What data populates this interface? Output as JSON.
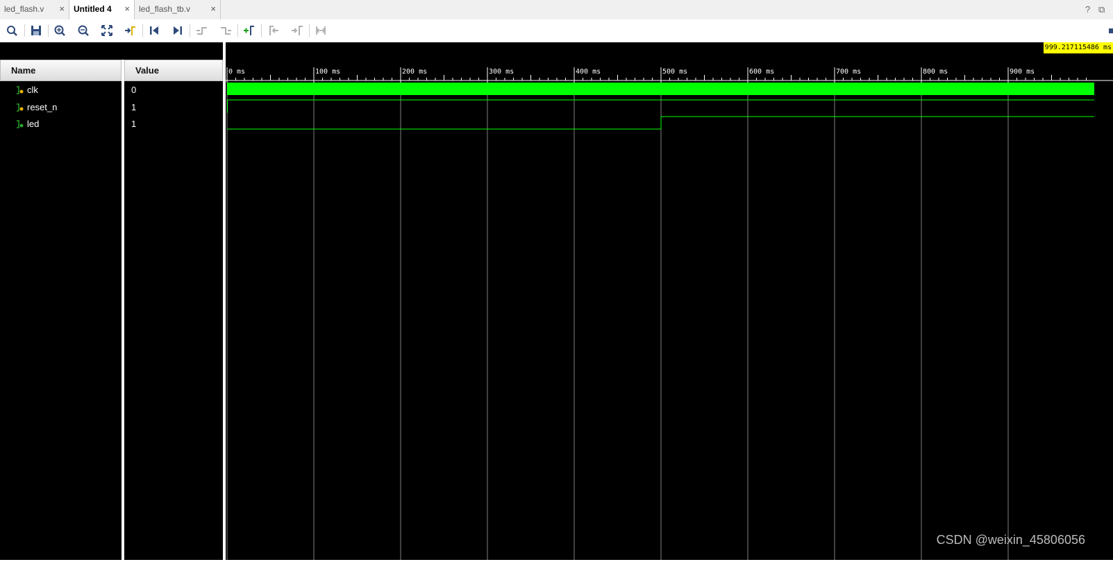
{
  "tabs": [
    {
      "label": "led_flash.v",
      "active": false
    },
    {
      "label": "Untitled 4",
      "active": true
    },
    {
      "label": "led_flash_tb.v",
      "active": false
    }
  ],
  "tab_close_glyph": "×",
  "window_controls": {
    "help": "?",
    "restore": "⧉"
  },
  "toolbar_icons": [
    "search-icon",
    "save-icon",
    "zoom-in-icon",
    "zoom-out-icon",
    "zoom-fit-icon",
    "go-to-cursor-icon",
    "go-to-start-icon",
    "go-to-end-icon",
    "previous-transition-icon",
    "next-transition-icon",
    "add-marker-icon",
    "previous-marker-icon",
    "next-marker-icon",
    "swap-cursors-icon"
  ],
  "columns": {
    "name": "Name",
    "value": "Value"
  },
  "signals": [
    {
      "name": "clk",
      "value": "0"
    },
    {
      "name": "reset_n",
      "value": "1"
    },
    {
      "name": "led",
      "value": "1"
    }
  ],
  "timeline": {
    "ticks": [
      "0 ms",
      "100 ms",
      "200 ms",
      "300 ms",
      "400 ms",
      "500 ms",
      "600 ms",
      "700 ms",
      "800 ms",
      "900 ms"
    ],
    "start_ms": 0,
    "end_ms": 999.217115486,
    "cursor_label": "999.217115486 ms"
  },
  "waveform_events": {
    "reset_n_high_from_ms": 0.5,
    "led_transitions_ms": [
      0,
      500
    ],
    "led_levels": [
      0,
      1
    ]
  },
  "colors": {
    "wave": "#00ff00",
    "grid": "#808080",
    "cursor_bg": "#ffff00",
    "toolbar_icon": "#2d4a7a"
  },
  "watermark": "CSDN @weixin_45806056"
}
